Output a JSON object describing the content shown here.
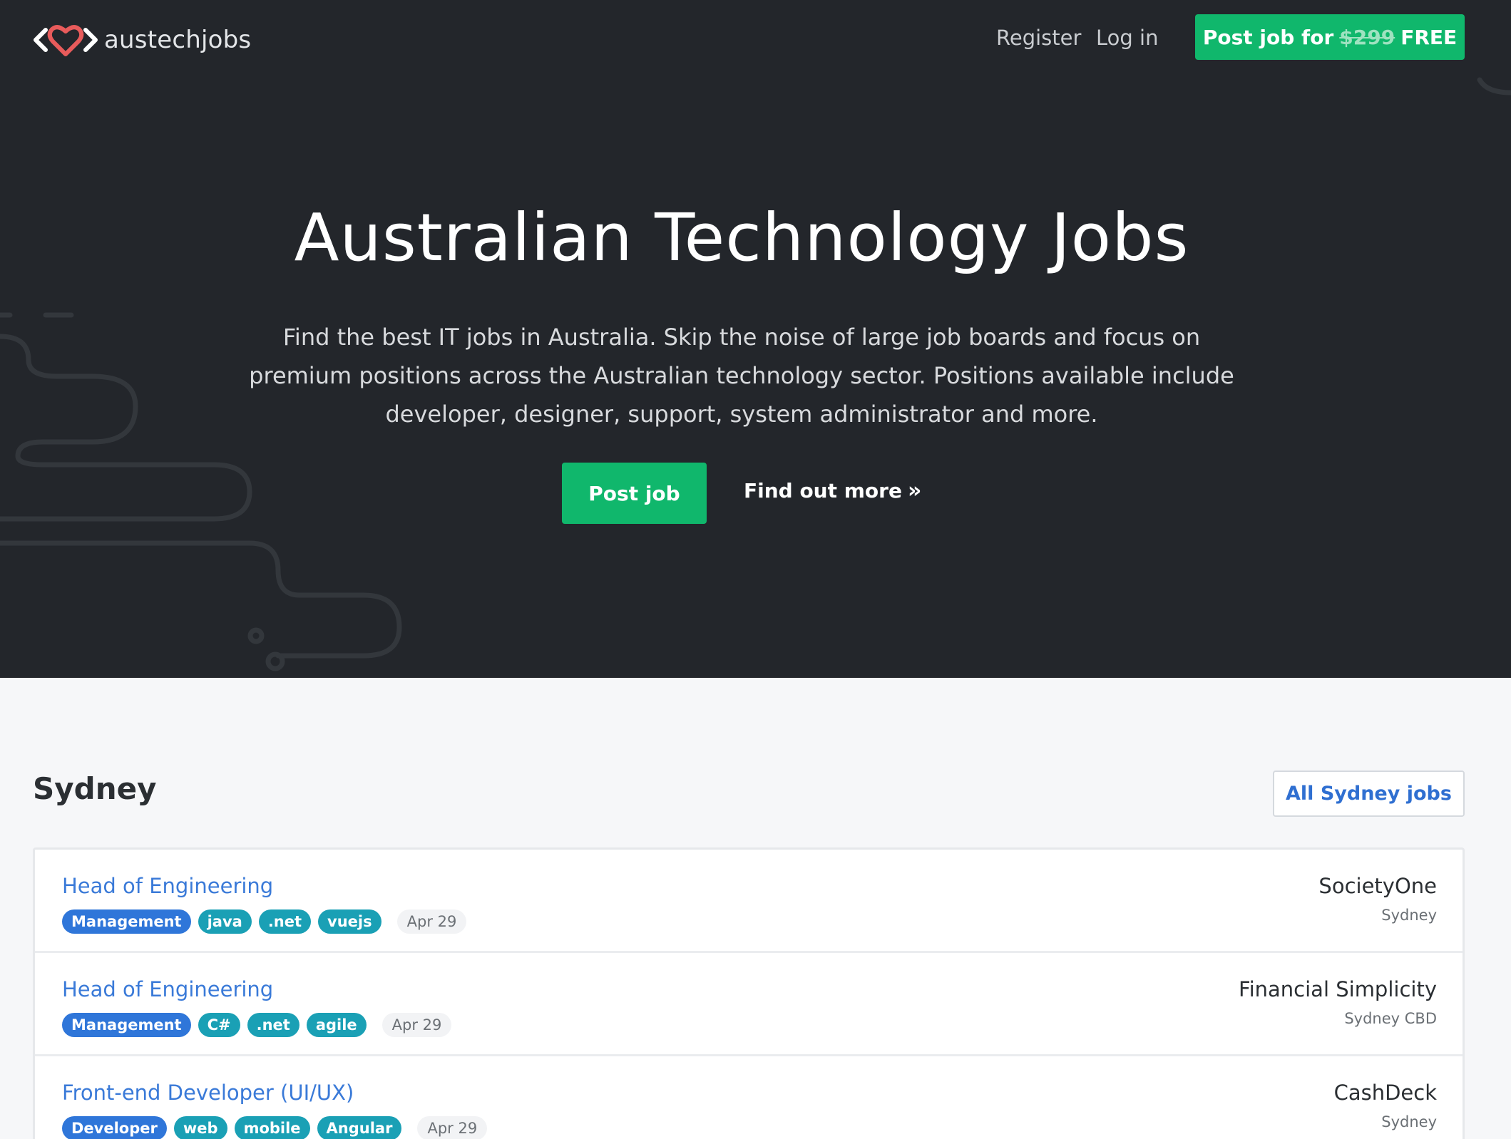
{
  "brand": {
    "name": "austechjobs",
    "logo": "code-heart-logo",
    "heart_color": "#e85b5b"
  },
  "nav": {
    "register": "Register",
    "login": "Log in",
    "post_prefix": "Post job for",
    "post_price": "$299",
    "post_suffix": "FREE"
  },
  "hero": {
    "title": "Australian Technology Jobs",
    "text": "Find the best IT jobs in Australia. Skip the noise of large job boards and focus on premium positions across the Australian technology sector. Positions available include developer, designer, support, system administrator and more.",
    "post_button": "Post job",
    "more_link": "Find out more",
    "more_icon": "double-chevron-right-icon"
  },
  "section": {
    "title": "Sydney",
    "all_button": "All Sydney jobs"
  },
  "jobs": [
    {
      "title": "Head of Engineering",
      "tags": [
        {
          "label": "Management",
          "kind": "blue"
        },
        {
          "label": "java",
          "kind": "teal"
        },
        {
          "label": ".net",
          "kind": "teal"
        },
        {
          "label": "vuejs",
          "kind": "teal"
        }
      ],
      "date": "Apr 29",
      "company": "SocietyOne",
      "location": "Sydney"
    },
    {
      "title": "Head of Engineering",
      "tags": [
        {
          "label": "Management",
          "kind": "blue"
        },
        {
          "label": "C#",
          "kind": "teal"
        },
        {
          "label": ".net",
          "kind": "teal"
        },
        {
          "label": "agile",
          "kind": "teal"
        }
      ],
      "date": "Apr 29",
      "company": "Financial Simplicity",
      "location": "Sydney CBD"
    },
    {
      "title": "Front-end Developer (UI/UX)",
      "tags": [
        {
          "label": "Developer",
          "kind": "blue"
        },
        {
          "label": "web",
          "kind": "teal"
        },
        {
          "label": "mobile",
          "kind": "teal"
        },
        {
          "label": "Angular",
          "kind": "teal"
        }
      ],
      "date": "Apr 29",
      "company": "CashDeck",
      "location": "Sydney"
    }
  ],
  "colors": {
    "hero_bg": "#23262b",
    "accent_green": "#10b76c",
    "link_blue": "#3a7ad8",
    "tag_blue": "#2f76d9",
    "tag_teal": "#1aa0b5"
  }
}
